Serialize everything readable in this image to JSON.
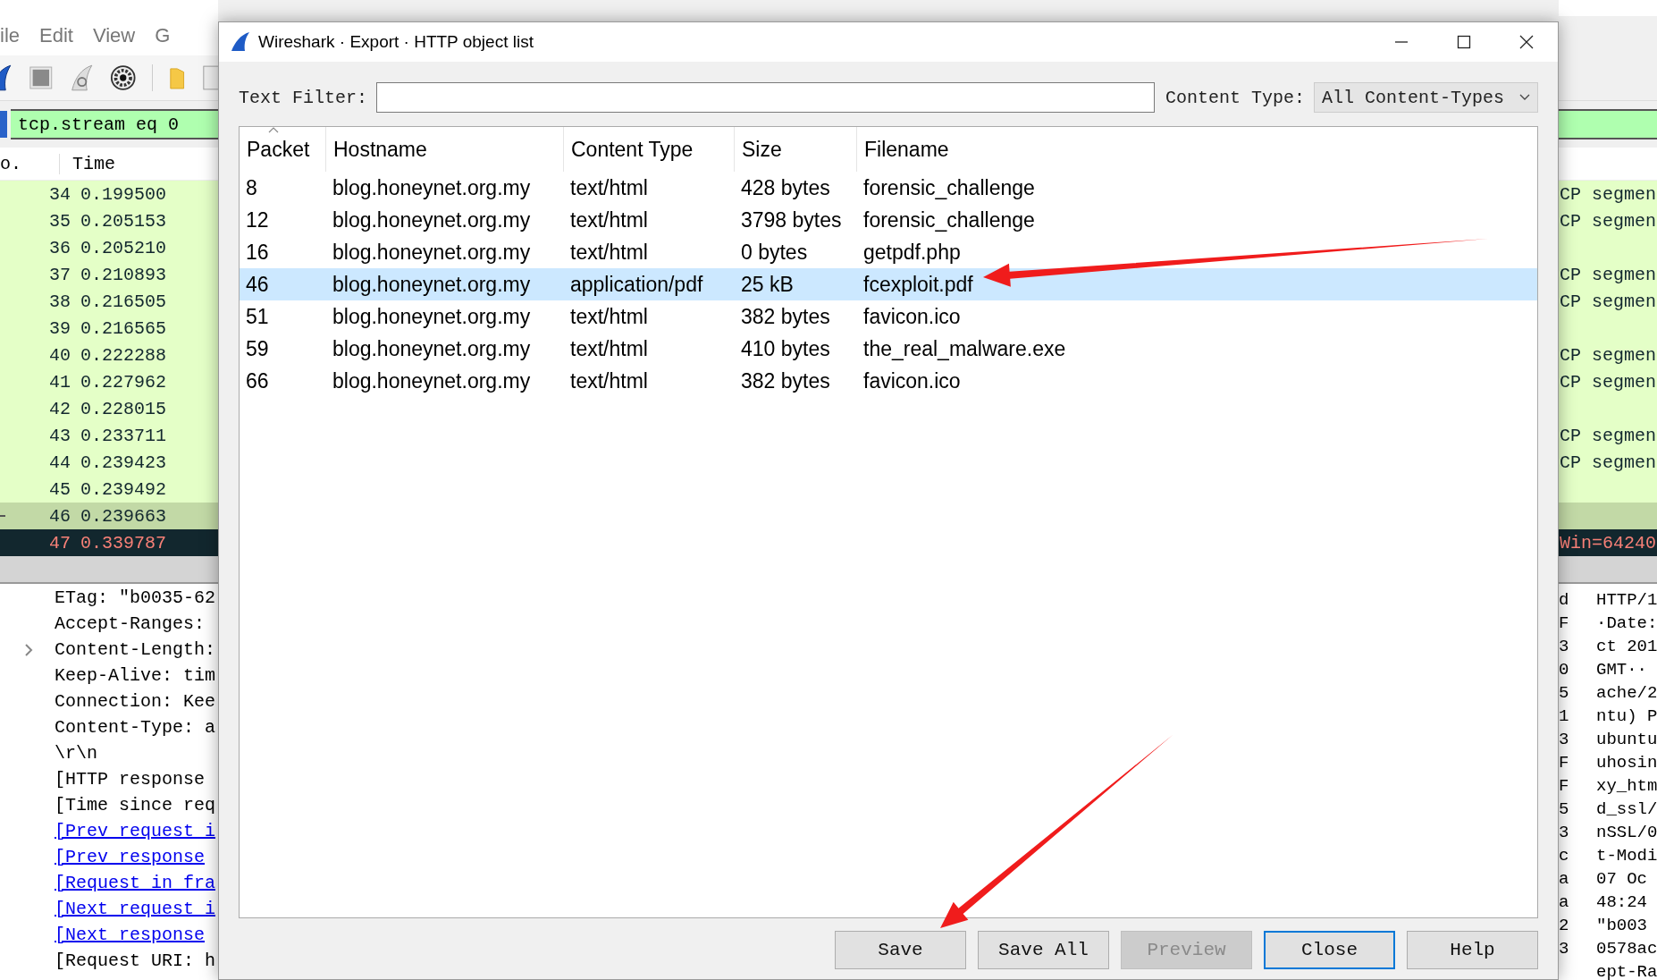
{
  "main_window": {
    "menu": [
      {
        "label": "ile"
      },
      {
        "label": "Edit"
      },
      {
        "label": "View"
      },
      {
        "label": "G"
      }
    ],
    "display_filter": "tcp.stream eq 0",
    "packet_list": {
      "columns": [
        "o.",
        "Time"
      ],
      "rows": [
        {
          "no": "34",
          "time": "0.199500",
          "info": "CP segmen",
          "kind": "tcp",
          "selected": false
        },
        {
          "no": "35",
          "time": "0.205153",
          "info": "CP segmen",
          "kind": "tcp",
          "selected": false
        },
        {
          "no": "36",
          "time": "0.205210",
          "kind": "tcp",
          "selected": false
        },
        {
          "no": "37",
          "time": "0.210893",
          "info": "CP segmen",
          "kind": "tcp",
          "selected": false
        },
        {
          "no": "38",
          "time": "0.216505",
          "info": "CP segmen",
          "kind": "tcp",
          "selected": false
        },
        {
          "no": "39",
          "time": "0.216565",
          "kind": "tcp",
          "selected": false
        },
        {
          "no": "40",
          "time": "0.222288",
          "info": "CP segmen",
          "kind": "tcp",
          "selected": false
        },
        {
          "no": "41",
          "time": "0.227962",
          "info": "CP segmen",
          "kind": "tcp",
          "selected": false
        },
        {
          "no": "42",
          "time": "0.228015",
          "kind": "tcp",
          "selected": false
        },
        {
          "no": "43",
          "time": "0.233711",
          "info": "CP segmen",
          "kind": "tcp",
          "selected": false
        },
        {
          "no": "44",
          "time": "0.239423",
          "info": "CP segmen",
          "kind": "tcp",
          "selected": false
        },
        {
          "no": "45",
          "time": "0.239492",
          "kind": "tcp",
          "selected": false
        },
        {
          "no": "46",
          "time": "0.239663",
          "kind": "tcp",
          "selected": true
        },
        {
          "no": "47",
          "time": "0.339787",
          "info": "Win=64240",
          "kind": "bad",
          "selected": false
        }
      ]
    },
    "packet_details": [
      {
        "text": "ETag: \"b0035-62",
        "kind": "field",
        "expandable": false
      },
      {
        "text": "Accept-Ranges:",
        "kind": "field",
        "expandable": false
      },
      {
        "text": "Content-Length:",
        "kind": "field",
        "expandable": true
      },
      {
        "text": "Keep-Alive: tim",
        "kind": "field",
        "expandable": false
      },
      {
        "text": "Connection: Kee",
        "kind": "field",
        "expandable": false
      },
      {
        "text": "Content-Type: a",
        "kind": "field",
        "expandable": false
      },
      {
        "text": "\\r\\n",
        "kind": "field",
        "expandable": false
      },
      {
        "text": "[HTTP response",
        "kind": "field",
        "expandable": false
      },
      {
        "text": "[Time since req",
        "kind": "field",
        "expandable": false
      },
      {
        "text": "[Prev request i",
        "kind": "link",
        "expandable": false
      },
      {
        "text": "[Prev response",
        "kind": "link",
        "expandable": false
      },
      {
        "text": "[Request in fra",
        "kind": "link",
        "expandable": false
      },
      {
        "text": "[Next request i",
        "kind": "link",
        "expandable": false
      },
      {
        "text": "[Next response",
        "kind": "link",
        "expandable": false
      },
      {
        "text": "[Request URI: h",
        "kind": "field",
        "expandable": false
      }
    ],
    "packet_bytes": [
      {
        "hex": "d",
        "ascii": "HTTP/1"
      },
      {
        "hex": "F",
        "ascii": "·Date:"
      },
      {
        "hex": "3",
        "ascii": "ct 201"
      },
      {
        "hex": "0",
        "ascii": " GMT··"
      },
      {
        "hex": "5",
        "ascii": "ache/2"
      },
      {
        "hex": "1",
        "ascii": "ntu) P"
      },
      {
        "hex": "3",
        "ascii": "ubuntu"
      },
      {
        "hex": "F",
        "ascii": "uhosin"
      },
      {
        "hex": "F",
        "ascii": "xy_htm"
      },
      {
        "hex": "5",
        "ascii": "d_ssl/"
      },
      {
        "hex": "3",
        "ascii": "nSSL/0"
      },
      {
        "hex": "c",
        "ascii": "t-Modi"
      },
      {
        "hex": "a",
        "ascii": " 07 Oc"
      },
      {
        "hex": "a",
        "ascii": "48:24"
      },
      {
        "hex": "2",
        "ascii": " \"b003"
      },
      {
        "hex": "3",
        "ascii": "0578ac"
      },
      {
        "ascii": "ept-Ra"
      }
    ]
  },
  "dialog": {
    "title": "Wireshark · Export · HTTP object list",
    "text_filter": {
      "label": "Text Filter:"
    },
    "content_type": {
      "label": "Content Type:",
      "value": "All Content-Types"
    },
    "table": {
      "columns": [
        {
          "label": "Packet",
          "sorted": true
        },
        {
          "label": "Hostname",
          "sorted": false
        },
        {
          "label": "Content Type",
          "sorted": false
        },
        {
          "label": "Size",
          "sorted": false
        },
        {
          "label": "Filename",
          "sorted": false
        }
      ],
      "rows": [
        {
          "packet": "8",
          "hostname": "blog.honeynet.org.my",
          "content_type": "text/html",
          "size": "428 bytes",
          "filename": "forensic_challenge",
          "selected": false
        },
        {
          "packet": "12",
          "hostname": "blog.honeynet.org.my",
          "content_type": "text/html",
          "size": "3798 bytes",
          "filename": "forensic_challenge",
          "selected": false
        },
        {
          "packet": "16",
          "hostname": "blog.honeynet.org.my",
          "content_type": "text/html",
          "size": "0 bytes",
          "filename": "getpdf.php",
          "selected": false
        },
        {
          "packet": "46",
          "hostname": "blog.honeynet.org.my",
          "content_type": "application/pdf",
          "size": "25 kB",
          "filename": "fcexploit.pdf",
          "selected": true
        },
        {
          "packet": "51",
          "hostname": "blog.honeynet.org.my",
          "content_type": "text/html",
          "size": "382 bytes",
          "filename": "favicon.ico",
          "selected": false
        },
        {
          "packet": "59",
          "hostname": "blog.honeynet.org.my",
          "content_type": "text/html",
          "size": "410 bytes",
          "filename": "the_real_malware.exe",
          "selected": false
        },
        {
          "packet": "66",
          "hostname": "blog.honeynet.org.my",
          "content_type": "text/html",
          "size": "382 bytes",
          "filename": "favicon.ico",
          "selected": false
        }
      ]
    },
    "buttons": [
      {
        "label": "Save",
        "disabled": false,
        "focused": false
      },
      {
        "label": "Save All",
        "disabled": false,
        "focused": false
      },
      {
        "label": "Preview",
        "disabled": true,
        "focused": false
      },
      {
        "label": "Close",
        "disabled": false,
        "focused": true
      },
      {
        "label": "Help",
        "disabled": false,
        "focused": false
      }
    ]
  },
  "annotations": [
    {
      "kind": "arrow"
    },
    {
      "kind": "arrow"
    }
  ]
}
